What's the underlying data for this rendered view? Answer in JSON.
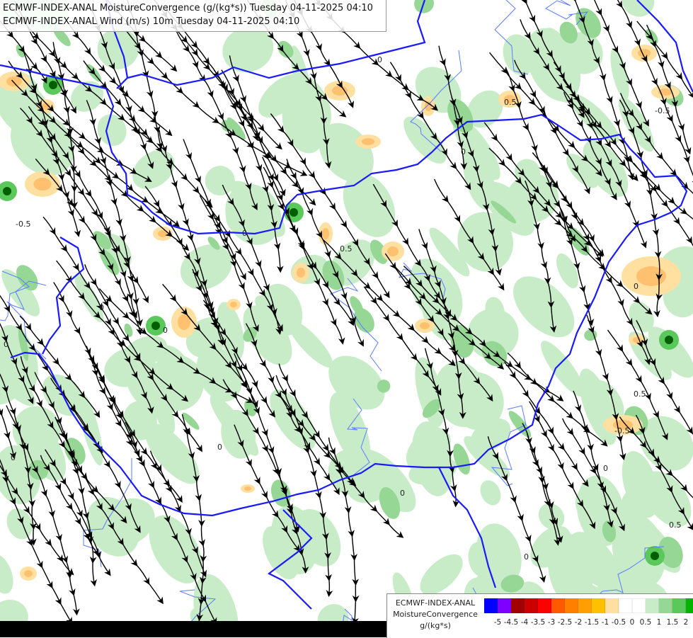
{
  "header": {
    "line1": "ECMWF-INDEX-ANAL MoistureConvergence (g/(kg*s)) Tuesday 04-11-2025 04:10",
    "line2": "ECMWF-INDEX-ANAL Wind (m/s) 10m Tuesday 04-11-2025 04:10"
  },
  "map": {
    "contour_labels": [
      "0",
      "0",
      "0",
      "0",
      "-0.5",
      "0",
      "0",
      "0",
      "0",
      "0",
      "-0.5",
      "0.5",
      "0.5",
      "0",
      "0",
      "0.5",
      "0.5",
      "-0.5",
      "0"
    ]
  },
  "legend": {
    "line1": "ECMWF-INDEX-ANAL",
    "line2": "MoistureConvergence",
    "line3": "g/(kg*s)",
    "colors": [
      "#0000ff",
      "#8000ff",
      "#a00000",
      "#cc0000",
      "#ff0000",
      "#ff5a00",
      "#ff8000",
      "#ffa000",
      "#ffc000",
      "#ffe0a0",
      "#ffffff",
      "#ffffff",
      "#c8ecc8",
      "#96d796",
      "#5ac85a",
      "#00b400"
    ],
    "tick_labels": [
      "-5",
      "-4.5",
      "-4",
      "-3.5",
      "-3",
      "-2.5",
      "-2",
      "-1.5",
      "-1",
      "-0.5",
      "0",
      "0.5",
      "1",
      "1.5",
      "2"
    ]
  },
  "colors": {
    "border": "#1a1aff",
    "river": "#5a7dff",
    "streamline": "#000000",
    "convergence_light": "#c8ecc8",
    "convergence_mid": "#96d796",
    "convergence_strong": "#00b400",
    "divergence_light": "#ffe0a0",
    "divergence_mid": "#ffc070"
  }
}
